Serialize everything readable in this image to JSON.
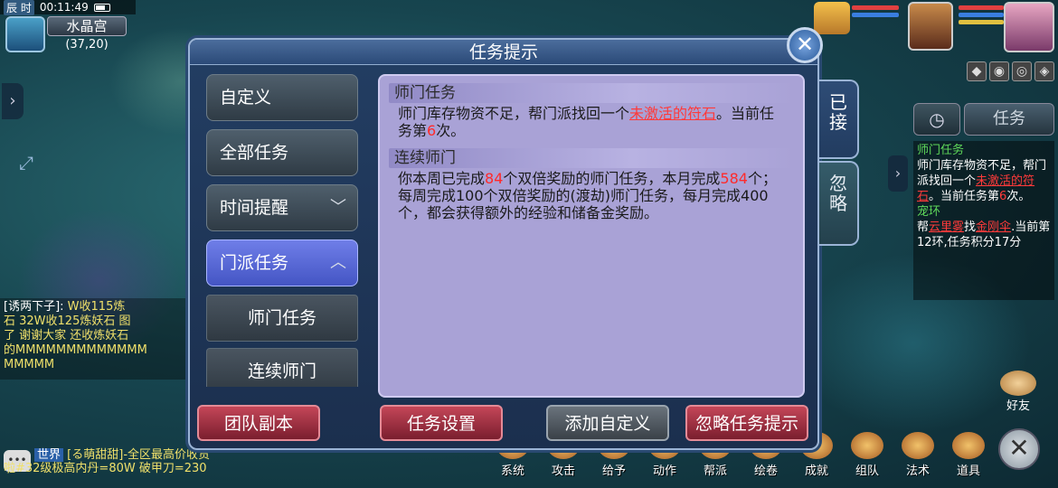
{
  "status": {
    "shichen": "辰 时",
    "clock": "00:11:49",
    "map_name": "水晶宫",
    "coords": "(37,20)"
  },
  "dialog": {
    "title": "任务提示",
    "close_icon": "close-x-icon",
    "menu": [
      {
        "label": "自定义",
        "type": "item"
      },
      {
        "label": "全部任务",
        "type": "item"
      },
      {
        "label": "时间提醒",
        "type": "expandable",
        "expanded": false,
        "chevron": "chevron-down-icon"
      },
      {
        "label": "门派任务",
        "type": "expandable",
        "expanded": true,
        "chevron": "chevron-up-icon"
      },
      {
        "label": "师门任务",
        "type": "sub"
      },
      {
        "label": "连续师门",
        "type": "sub"
      }
    ],
    "sections": [
      {
        "head": "师门任务",
        "text_1": "师门库存物资不足，帮门派找回一个",
        "link": "未激活的符石",
        "text_2": "。当前任务第",
        "count": "6",
        "text_3": "次。"
      },
      {
        "head": "连续师门",
        "text_1": "你本周已完成",
        "weekly_done": "84",
        "text_2": "个双倍奖励的师门任务，本月完成",
        "monthly_done": "584",
        "text_3": "个；每周完成100个双倍奖励的(渡劫)师门任务，每月完成400个，都会获得额外的经验和储备金奖励。"
      }
    ],
    "side_tabs": {
      "accepted": "已接",
      "ignored": "忽略"
    },
    "buttons": {
      "team_dungeon": "团队副本",
      "task_settings": "任务设置",
      "add_custom": "添加自定义",
      "ignore_tip": "忽略任务提示"
    }
  },
  "tracker": {
    "tab_label": "任务",
    "t1_title": "师门任务",
    "t1_text_1": "师门库存物资不足，帮门派找回一个",
    "t1_link": "未激活的符石",
    "t1_text_2": "。当前任务第",
    "t1_count": "6",
    "t1_text_3": "次。",
    "t2_title": "宠环",
    "t2_text_1": "帮",
    "t2_npc": "云里雾",
    "t2_text_2": "找",
    "t2_item": "金刚伞",
    "t2_text_3": ".当前第12环,任务积分17分"
  },
  "chat": {
    "speaker": "[诱两下子]:",
    "line_1": "W收115炼",
    "line_2": "石 32W收125炼妖石 图",
    "line_3": "了 谢谢大家 还收炼妖石",
    "line_4": "的MMMMMMMMMMMMM",
    "line_5": "MMMMM",
    "world_tag": "世界",
    "world_speaker": "[る萌甜甜]",
    "world_msg": "-全区最高价收货",
    "world_msg_2": "啦#32级极高内丹=80W 破甲刀=230"
  },
  "bottom_bar": [
    {
      "label": "系统",
      "icon": "system-icon"
    },
    {
      "label": "攻击",
      "icon": "attack-icon"
    },
    {
      "label": "给予",
      "icon": "give-icon"
    },
    {
      "label": "动作",
      "icon": "action-icon"
    },
    {
      "label": "帮派",
      "icon": "guild-icon"
    },
    {
      "label": "绘卷",
      "icon": "scroll-icon"
    },
    {
      "label": "成就",
      "icon": "achievement-icon"
    },
    {
      "label": "组队",
      "icon": "team-icon"
    },
    {
      "label": "法术",
      "icon": "spell-icon"
    },
    {
      "label": "道具",
      "icon": "item-icon"
    }
  ],
  "friends_label": "好友",
  "colors": {
    "highlight_red": "#ff2a2a",
    "panel_bg": "#a9a2d6",
    "active_menu": "#5566d8",
    "tracker_title": "#5fd85a"
  }
}
